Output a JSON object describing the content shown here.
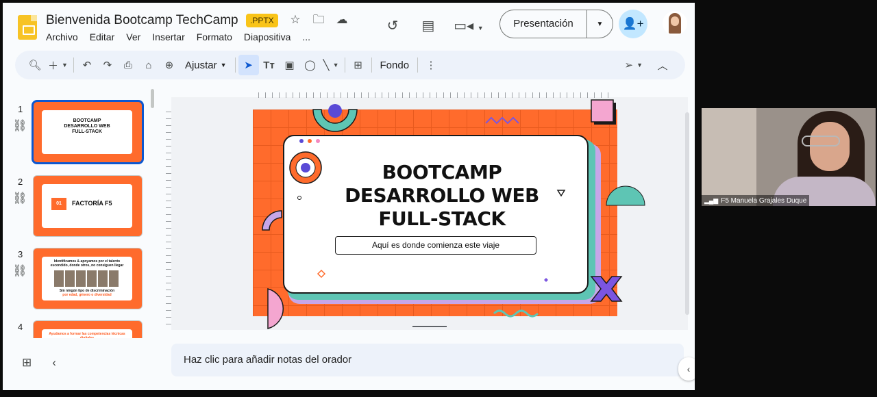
{
  "doc": {
    "title": "Bienvenida Bootcamp TechCamp",
    "badge": ".PPTX",
    "menu": [
      "Archivo",
      "Editar",
      "Ver",
      "Insertar",
      "Formato",
      "Diapositiva",
      "..."
    ]
  },
  "header": {
    "present_label": "Presentación"
  },
  "toolbar": {
    "zoom_label": "Ajustar",
    "background_label": "Fondo"
  },
  "filmstrip": {
    "slides": [
      {
        "num": "1",
        "title": "BOOTCAMP DESARROLLO WEB FULL-STACK"
      },
      {
        "num": "2",
        "title": "FACTORÍA F5",
        "chip": "01"
      },
      {
        "num": "3",
        "title": "Identificamos & apoyamos por el talento escondido, donde otros, no consiguen llegar",
        "footer1": "Sin ningún tipo de discriminación",
        "footer2": "por edad, género o diversidad"
      },
      {
        "num": "4",
        "title": "Ayudamos a formar las competencias técnicas digitales"
      }
    ]
  },
  "slide": {
    "title_line1": "BOOTCAMP",
    "title_line2": "DESARROLLO WEB",
    "title_line3": "FULL-STACK",
    "subtitle": "Aquí es donde comienza este viaje",
    "colors": {
      "orange": "#ff6b2c",
      "teal": "#5ec5b4",
      "lilac": "#c7a6e8",
      "pink": "#f4a6d0",
      "purple": "#7b55e0"
    }
  },
  "notes": {
    "placeholder": "Haz clic para añadir notas del orador"
  },
  "video": {
    "name": "F5 Manuela Grajales Duque"
  }
}
